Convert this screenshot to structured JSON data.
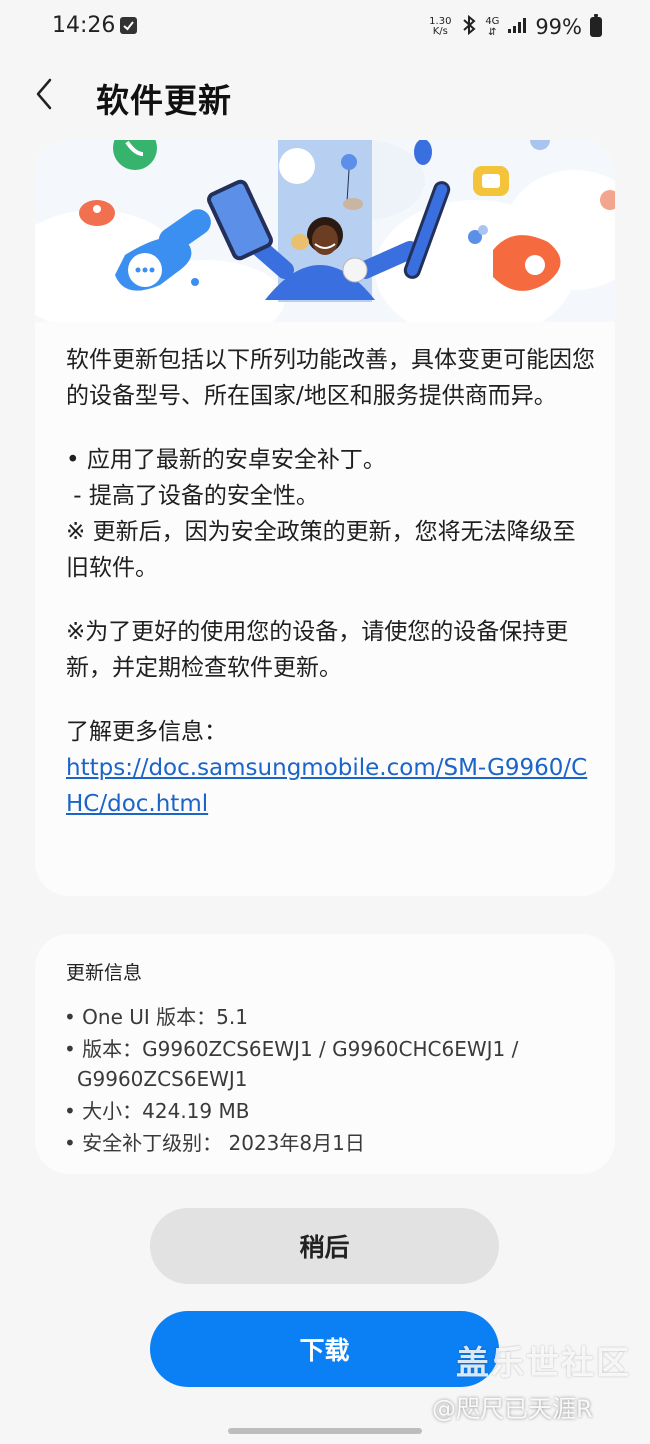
{
  "status_bar": {
    "time": "14:26",
    "net_speed_value": "1.30",
    "net_speed_unit": "K/s",
    "network_type": "4G",
    "battery": "99%"
  },
  "header": {
    "title": "软件更新"
  },
  "notes": {
    "intro": "软件更新包括以下所列功能改善，具体变更可能因您的设备型号、所在国家/地区和服务提供商而异。",
    "bullet_1": "• 应用了最新的安卓安全补丁。",
    "bullet_1_sub": " - 提高了设备的安全性。",
    "notice_1": "※ 更新后，因为安全政策的更新，您将无法降级至旧软件。",
    "notice_2": "※为了更好的使用您的设备，请使您的设备保持更新，并定期检查软件更新。",
    "more_info_label": "了解更多信息：",
    "more_info_link": "https://doc.samsungmobile.com/SM-G9960/CHC/doc.html"
  },
  "update_info": {
    "title": "更新信息",
    "one_ui": "• One UI 版本：5.1",
    "version": "• 版本：G9960ZCS6EWJ1 / G9960CHC6EWJ1 / G9960ZCS6EWJ1",
    "size": "• 大小：424.19 MB",
    "security_patch": "• 安全补丁级别： 2023年8月1日"
  },
  "buttons": {
    "later": "稍后",
    "download": "下载"
  },
  "watermark": {
    "main": "盖乐世社区",
    "sub": "@咫尺已天涯R"
  },
  "colors": {
    "accent": "#0a80f4",
    "link": "#1b64c8",
    "card_background": "#fcfcfc",
    "page_background": "#f6f6f6"
  }
}
